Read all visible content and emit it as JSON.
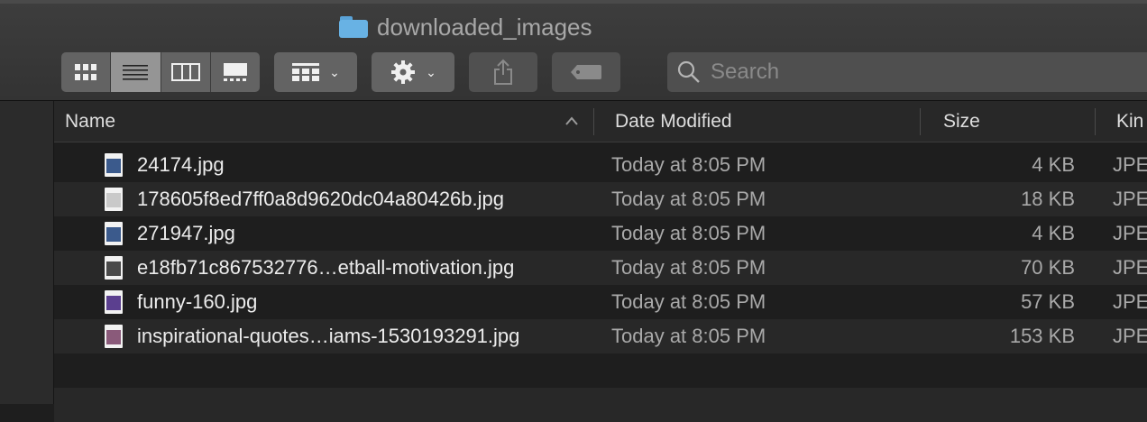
{
  "window": {
    "title": "downloaded_images",
    "folder_icon": "folder-icon",
    "accent": "#68b2e4"
  },
  "toolbar": {
    "view_modes": [
      {
        "name": "icon-view",
        "icon": "grid-icon"
      },
      {
        "name": "list-view",
        "icon": "list-icon",
        "active": true
      },
      {
        "name": "column-view",
        "icon": "columns-icon"
      },
      {
        "name": "gallery-view",
        "icon": "gallery-icon"
      }
    ],
    "group_icon": "group-icon",
    "action_icon": "gear-icon",
    "share_icon": "share-icon",
    "tags_icon": "tag-icon",
    "search_placeholder": "Search",
    "search_value": ""
  },
  "columns": {
    "name": "Name",
    "date": "Date Modified",
    "size": "Size",
    "kind": "Kind",
    "kind_visible": "Kin"
  },
  "files": [
    {
      "name": "24174.jpg",
      "date": "Today at 8:05 PM",
      "size": "4 KB",
      "kind": "JPE",
      "thumb": "#3b5a8c"
    },
    {
      "name": "178605f8ed7ff0a8d9620dc04a80426b.jpg",
      "date": "Today at 8:05 PM",
      "size": "18 KB",
      "kind": "JPE",
      "thumb": "#c9c9c9"
    },
    {
      "name": "271947.jpg",
      "date": "Today at 8:05 PM",
      "size": "4 KB",
      "kind": "JPE",
      "thumb": "#3b5a8c"
    },
    {
      "name": "e18fb71c867532776…etball-motivation.jpg",
      "date": "Today at 8:05 PM",
      "size": "70 KB",
      "kind": "JPE",
      "thumb": "#4a4a4a"
    },
    {
      "name": "funny-160.jpg",
      "date": "Today at 8:05 PM",
      "size": "57 KB",
      "kind": "JPE",
      "thumb": "#5b3f8f"
    },
    {
      "name": "inspirational-quotes…iams-1530193291.jpg",
      "date": "Today at 8:05 PM",
      "size": "153 KB",
      "kind": "JPE",
      "thumb": "#8a5a7a"
    }
  ]
}
